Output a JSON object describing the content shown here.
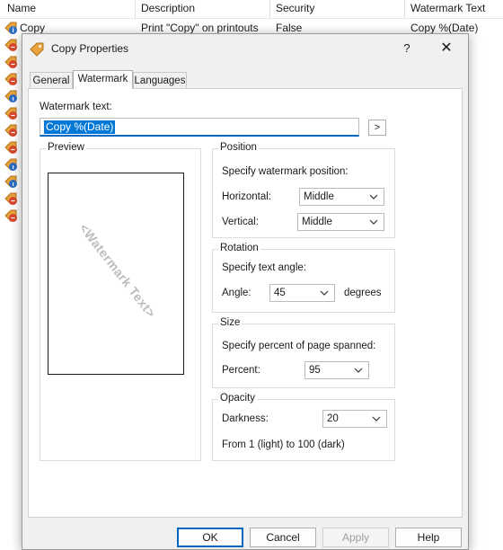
{
  "list": {
    "columns": [
      "Name",
      "Description",
      "Security",
      "Watermark Text"
    ],
    "row": {
      "name": "Copy",
      "description": "Print \"Copy\" on printouts",
      "security": "False",
      "watermark": "Copy %(Date)"
    }
  },
  "dialog": {
    "title": "Copy Properties",
    "help": "?",
    "close": "✕",
    "tabs": [
      "General",
      "Watermark",
      "Languages"
    ],
    "active_tab": "Watermark",
    "watermark_label": "Watermark text:",
    "watermark_value": "Copy %(Date)",
    "insert_button": ">",
    "preview": {
      "title": "Preview",
      "sample": "<Watermark Text>"
    },
    "position": {
      "title": "Position",
      "hint": "Specify watermark position:",
      "horizontal_label": "Horizontal:",
      "horizontal_value": "Middle",
      "vertical_label": "Vertical:",
      "vertical_value": "Middle"
    },
    "rotation": {
      "title": "Rotation",
      "hint": "Specify text angle:",
      "angle_label": "Angle:",
      "angle_value": "45",
      "unit": "degrees"
    },
    "size": {
      "title": "Size",
      "hint": "Specify percent of page spanned:",
      "percent_label": "Percent:",
      "percent_value": "95"
    },
    "opacity": {
      "title": "Opacity",
      "darkness_label": "Darkness:",
      "darkness_value": "20",
      "range_note": "From 1 (light) to 100 (dark)"
    },
    "buttons": {
      "ok": "OK",
      "cancel": "Cancel",
      "apply": "Apply",
      "help": "Help"
    }
  },
  "colors": {
    "accent": "#0067c0",
    "selection": "#0078d7",
    "dialog_bg": "#f0f0f0"
  },
  "icons": [
    "tag-icon",
    "info-icon",
    "help-icon",
    "close-icon",
    "chevron-down-icon"
  ]
}
